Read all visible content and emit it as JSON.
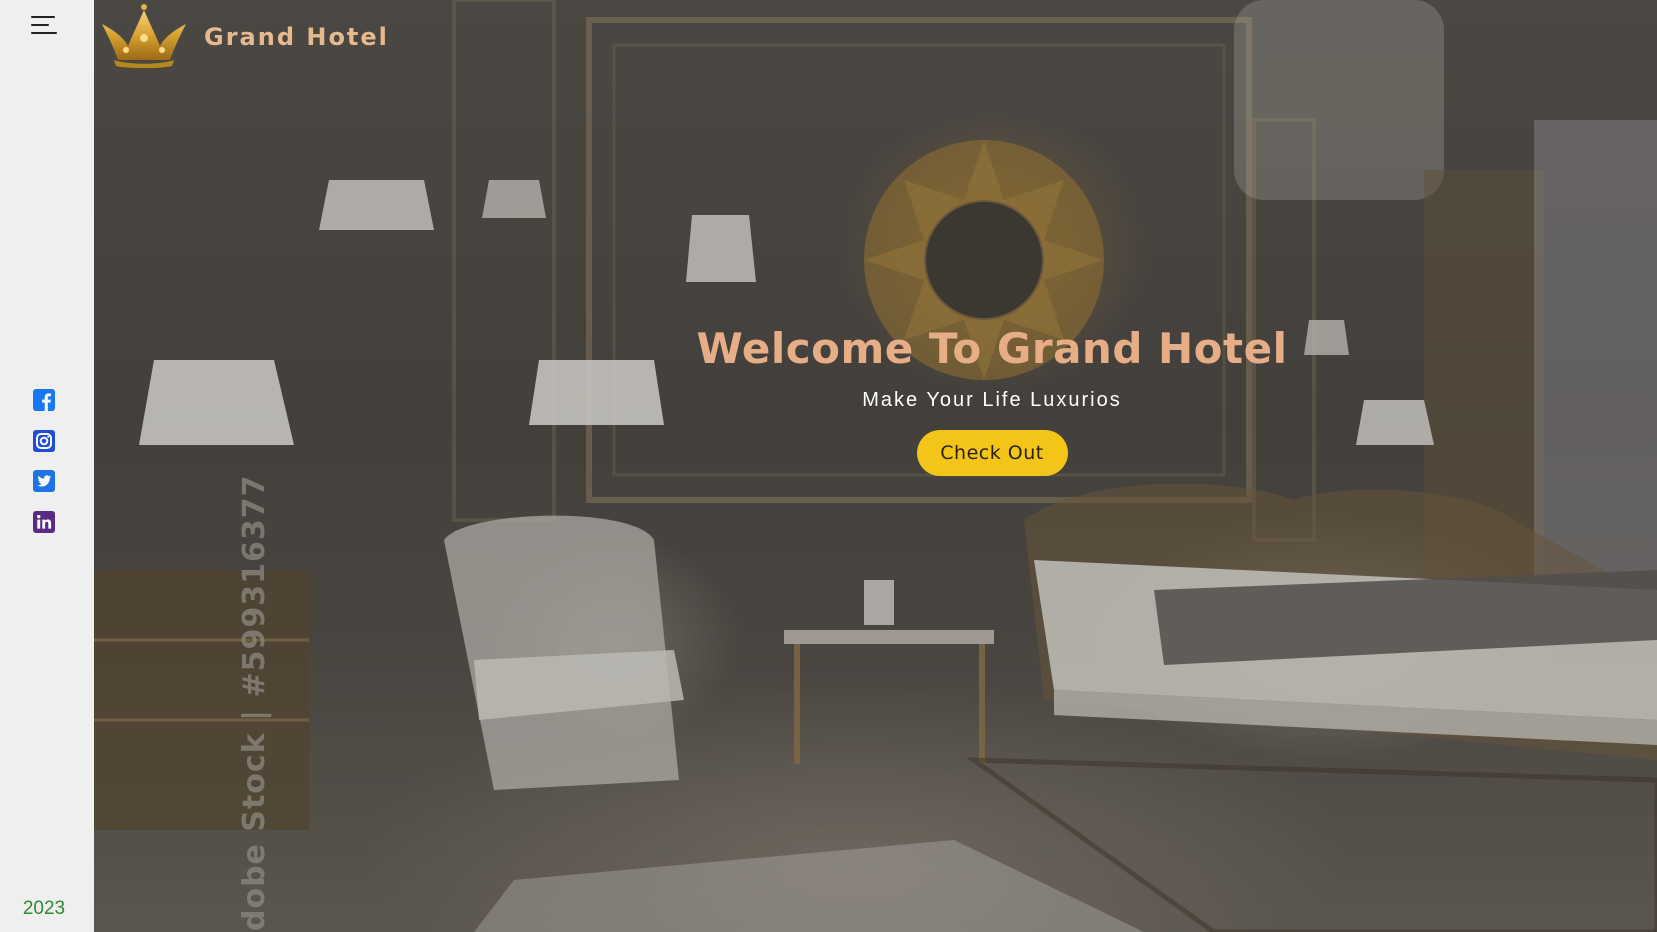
{
  "brand": {
    "name": "Grand Hotel",
    "logo_icon": "crown-icon",
    "name_color": "#e6b98e"
  },
  "sidebar": {
    "menu_icon": "hamburger-menu-icon",
    "socials": [
      {
        "name": "facebook",
        "icon": "facebook-icon",
        "color": "#1877f2"
      },
      {
        "name": "instagram",
        "icon": "instagram-icon",
        "color": "#1f4fd6"
      },
      {
        "name": "twitter",
        "icon": "twitter-icon",
        "color": "#1d74e8"
      },
      {
        "name": "linkedin",
        "icon": "linkedin-icon",
        "color": "#5b2a86"
      }
    ],
    "year": "2023"
  },
  "hero": {
    "headline": "Welcome To Grand Hotel",
    "subline": "Make Your Life Luxurios",
    "cta_label": "Check Out",
    "accent_color": "#f2c518",
    "headline_color": "#e7ad87"
  },
  "watermark": "dobe Stock | #599316377"
}
